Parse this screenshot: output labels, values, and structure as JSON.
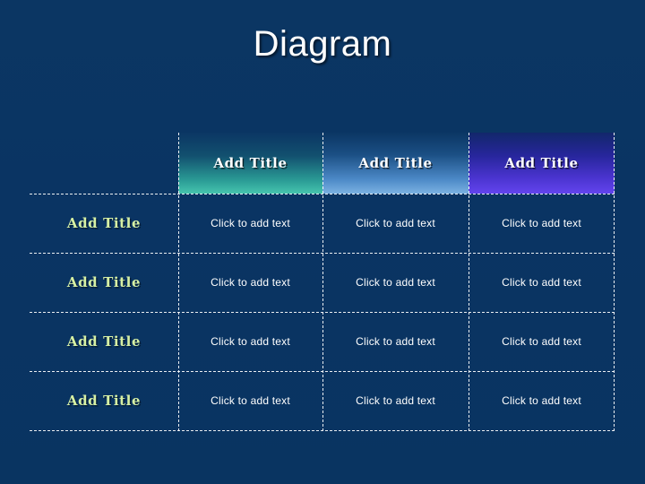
{
  "slide": {
    "title": "Diagram",
    "background_color": "#0a3564"
  },
  "table": {
    "column_headers": [
      {
        "label": "Add Title",
        "accent_color": "#47c5ae"
      },
      {
        "label": "Add Title",
        "accent_color": "#7cb2e2"
      },
      {
        "label": "Add Title",
        "accent_color": "#6344ee"
      }
    ],
    "row_label_color": "#d7f0a4",
    "rows": [
      {
        "label": "Add Title",
        "cells": [
          "Click to add text",
          "Click to add text",
          "Click to add text"
        ]
      },
      {
        "label": "Add Title",
        "cells": [
          "Click to add text",
          "Click to add text",
          "Click to add text"
        ]
      },
      {
        "label": "Add Title",
        "cells": [
          "Click to add text",
          "Click to add text",
          "Click to add text"
        ]
      },
      {
        "label": "Add Title",
        "cells": [
          "Click to add text",
          "Click to add text",
          "Click to add text"
        ]
      }
    ]
  }
}
